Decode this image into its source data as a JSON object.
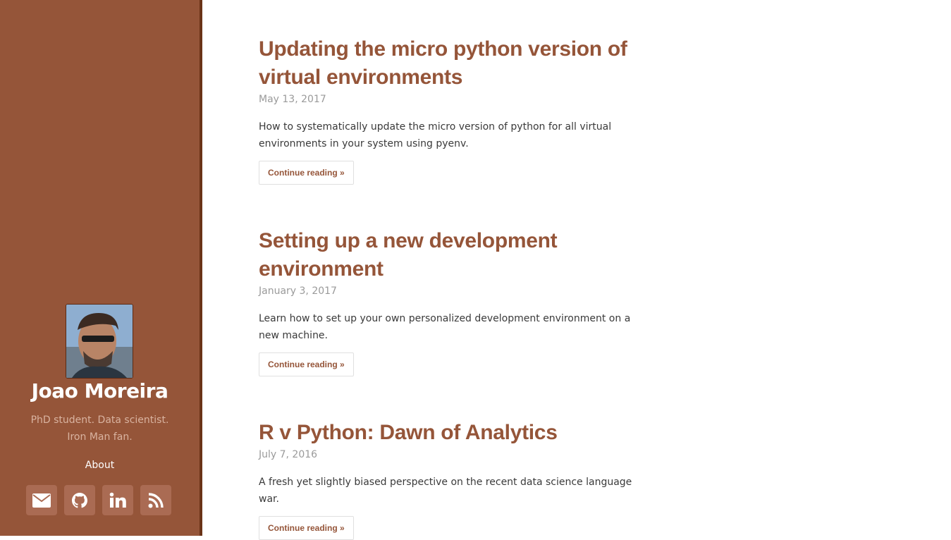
{
  "sidebar": {
    "author_name": "Joao Moreira",
    "bio": "PhD student. Data scientist. Iron Man fan.",
    "nav": [
      {
        "label": "About"
      }
    ],
    "social": [
      {
        "icon": "email-icon"
      },
      {
        "icon": "github-icon"
      },
      {
        "icon": "linkedin-icon"
      },
      {
        "icon": "rss-icon"
      }
    ]
  },
  "posts": [
    {
      "title": "Updating the micro python version of virtual environments",
      "date": "May 13, 2017",
      "excerpt": "How to systematically update the micro version of python for all virtual environments in your system using pyenv.",
      "read_more": "Continue reading »"
    },
    {
      "title": "Setting up a new development environment",
      "date": "January 3, 2017",
      "excerpt": "Learn how to set up your own personalized development environment on a new machine.",
      "read_more": "Continue reading »"
    },
    {
      "title": "R v Python: Dawn of Analytics",
      "date": "July 7, 2016",
      "excerpt": "A fresh yet slightly biased perspective on the recent data science language war.",
      "read_more": "Continue reading »"
    }
  ],
  "colors": {
    "sidebar_bg": "#955539",
    "accent": "#955539",
    "social_button_bg": "#aa6b53"
  }
}
